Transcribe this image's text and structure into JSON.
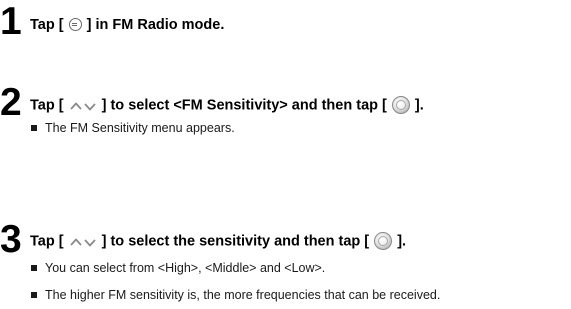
{
  "steps": [
    {
      "number": "1",
      "heading": {
        "before": "Tap [",
        "icons": [
          "menu-button-icon"
        ],
        "after": "] in FM Radio mode."
      },
      "bullets": []
    },
    {
      "number": "2",
      "heading": {
        "before": "Tap [",
        "icons": [
          "up-down-arrows-icon",
          "center-select-button-icon"
        ],
        "middle": "] to select <FM Sensitivity> and then tap [",
        "after": "]."
      },
      "bullets": [
        "The FM Sensitivity menu appears."
      ]
    },
    {
      "number": "3",
      "heading": {
        "before": "Tap [",
        "icons": [
          "up-down-arrows-icon",
          "center-select-button-icon"
        ],
        "middle": "] to select the sensitivity and then tap [",
        "after": "]."
      },
      "bullets": [
        "You can select from <High>, <Middle> and <Low>.",
        "The higher FM sensitivity is, the more frequencies that can be received."
      ]
    }
  ],
  "colors": {
    "text": "#000000",
    "icon_gray": "#6a6a6a"
  }
}
